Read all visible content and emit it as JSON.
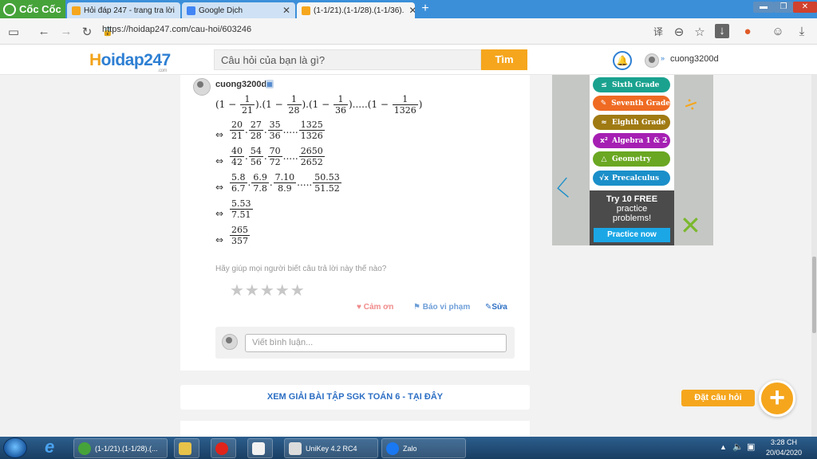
{
  "browser": {
    "brand": "Cốc Cốc",
    "tabs": [
      {
        "title": "Hỏi đáp 247 - trang tra lời",
        "active": false
      },
      {
        "title": "Google Dịch",
        "active": false
      },
      {
        "title": "(1-1/21).(1-1/28).(1-1/36).",
        "active": true
      }
    ],
    "new_tab": "+",
    "url": "https://hoidap247.com/cau-hoi/603246",
    "window_controls": [
      "minimize",
      "restore",
      "close"
    ]
  },
  "site": {
    "logo_h": "H",
    "logo_rest": "oidap247",
    "logo_sub": ".com",
    "search_placeholder": "Câu hỏi của bạn là gì?",
    "search_button": "Tìm",
    "username": "cuong3200d"
  },
  "answer": {
    "author": "cuong3200d",
    "lines": [
      {
        "lead": "",
        "terms": [
          {
            "pre": "(1 − ",
            "n": "1",
            "d": "21",
            "post": ")."
          },
          {
            "pre": "(1 − ",
            "n": "1",
            "d": "28",
            "post": ")."
          },
          {
            "pre": "(1 − ",
            "n": "1",
            "d": "36",
            "post": ")....."
          },
          {
            "pre": "(1 − ",
            "n": "1",
            "d": "1326",
            "post": ")"
          }
        ]
      },
      {
        "lead": "⇔",
        "terms": [
          {
            "n": "20",
            "d": "21",
            "post": "."
          },
          {
            "n": "27",
            "d": "28",
            "post": "."
          },
          {
            "n": "35",
            "d": "36",
            "post": "....."
          },
          {
            "n": "1325",
            "d": "1326",
            "post": ""
          }
        ]
      },
      {
        "lead": "⇔",
        "terms": [
          {
            "n": "40",
            "d": "42",
            "post": "."
          },
          {
            "n": "54",
            "d": "56",
            "post": "."
          },
          {
            "n": "70",
            "d": "72",
            "post": "....."
          },
          {
            "n": "2650",
            "d": "2652",
            "post": ""
          }
        ]
      },
      {
        "lead": "⇔",
        "terms": [
          {
            "n": "5.8",
            "d": "6.7",
            "post": "."
          },
          {
            "n": "6.9",
            "d": "7.8",
            "post": "."
          },
          {
            "n": "7.10",
            "d": "8.9",
            "post": "....."
          },
          {
            "n": "50.53",
            "d": "51.52",
            "post": ""
          }
        ]
      },
      {
        "lead": "⇔",
        "terms": [
          {
            "n": "5.53",
            "d": "7.51",
            "post": ""
          }
        ]
      },
      {
        "lead": "⇔",
        "terms": [
          {
            "n": "265",
            "d": "357",
            "post": ""
          }
        ]
      }
    ],
    "rating_question": "Hãy giúp mọi người biết câu trả lời này thế nào?",
    "stars": "★★★★★",
    "rating": 0,
    "actions": {
      "thanks": "Cảm ơn",
      "report": "Báo vi phạm",
      "edit": "Sửa"
    },
    "comment_placeholder": "Viết bình luận..."
  },
  "banner": "XEM GIẢI BÀI TẬP SGK TOÁN 6 - TẠI ĐÂY",
  "ad": {
    "items": [
      {
        "icon": "≤",
        "label": "Sixth Grade",
        "color": "#1aa28f"
      },
      {
        "icon": "✎",
        "label": "Seventh Grade",
        "color": "#ef6b23"
      },
      {
        "icon": "≈",
        "label": "Eighth Grade",
        "color": "#a07a13"
      },
      {
        "icon": "x²",
        "label": "Algebra 1 & 2",
        "color": "#a51fb3"
      },
      {
        "icon": "△",
        "label": "Geometry",
        "color": "#6aa722"
      },
      {
        "icon": "√x",
        "label": "Precalculus",
        "color": "#1b8fc9"
      }
    ],
    "promo_1": "Try 10 FREE",
    "promo_2": "practice",
    "promo_3": "problems!",
    "cta": "Practice now"
  },
  "ask_button": "Đặt câu hỏi",
  "ask_plus": "+",
  "taskbar": {
    "items": [
      {
        "label": "(1-1/21).(1-1/28).(...",
        "icon_color": "#46a33a"
      },
      {
        "label": "",
        "icon_color": "#e8c34a"
      },
      {
        "label": "",
        "icon_color": "#e0241b"
      },
      {
        "label": "",
        "icon_color": "#f2f2f2"
      },
      {
        "label": "UniKey 4.2 RC4",
        "icon_color": "#dcdcdc"
      },
      {
        "label": "Zalo",
        "icon_color": "#1a78f2"
      }
    ],
    "time": "3:28 CH",
    "date": "20/04/2020"
  }
}
